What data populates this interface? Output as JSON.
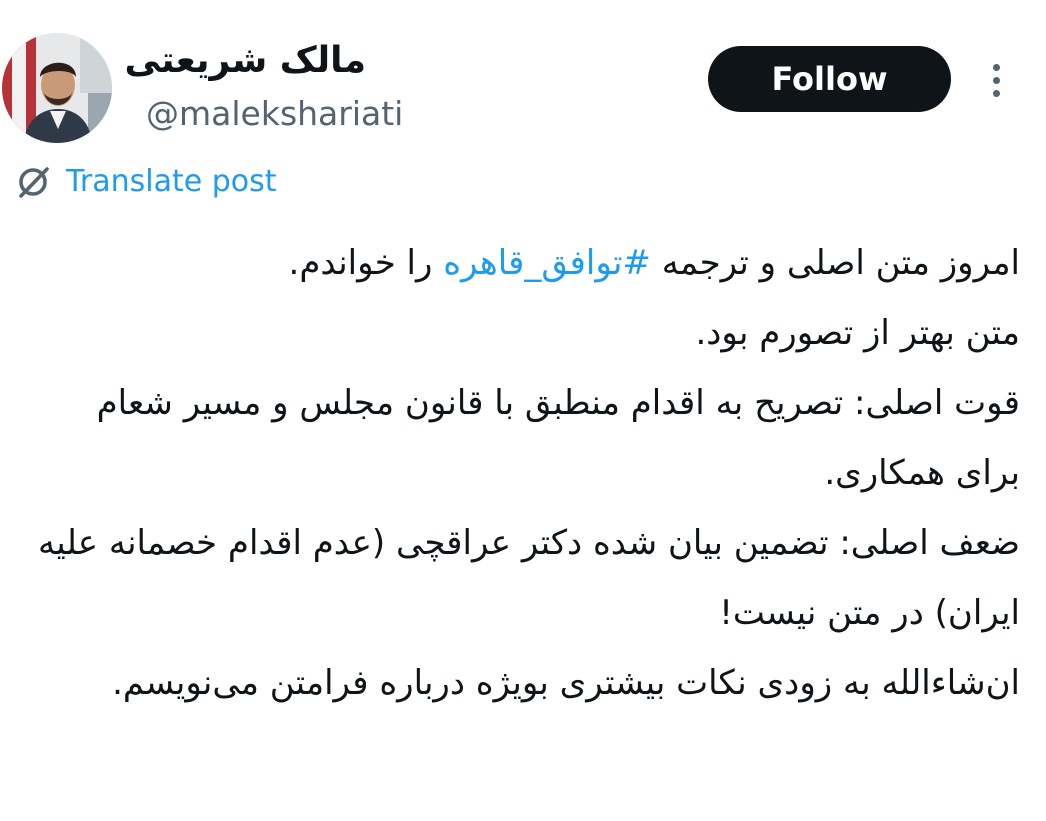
{
  "author": {
    "display_name": "مالک شریعتی",
    "handle": "@malekshariati",
    "avatar_icon": "profile-photo"
  },
  "actions": {
    "follow_label": "Follow",
    "more_icon": "more-vertical-icon"
  },
  "translate": {
    "icon": "translate-globe-icon",
    "label": "Translate post"
  },
  "post": {
    "line1_before": "امروز متن اصلی و ترجمه ",
    "hashtag": "#توافق_قاهره",
    "line1_after": " را خواندم.",
    "line2": "متن بهتر از تصورم بود.",
    "line3": "قوت اصلی: تصریح به اقدام منطبق با قانون مجلس و مسیر شعام برای همکاری.",
    "line4": "ضعف اصلی: تضمین بیان شده دکتر عراقچی (عدم اقدام خصمانه علیه ایران) در متن نیست!",
    "line5": "ان‌شاءالله به زودی نکات بیشتری بویژه درباره فرامتن می‌نویسم."
  },
  "colors": {
    "text": "#0f1419",
    "secondary": "#536471",
    "link": "#1d9bf0",
    "button_bg": "#0f1419",
    "button_text": "#ffffff"
  }
}
